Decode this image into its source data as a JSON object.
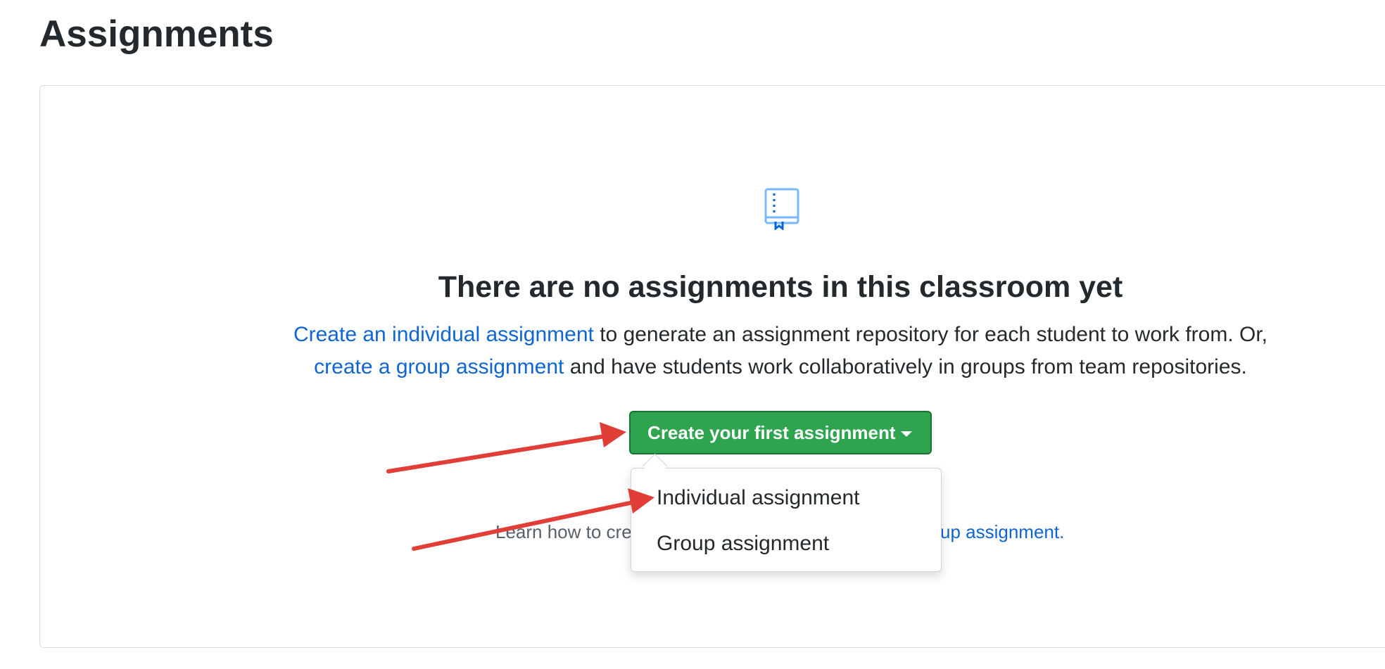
{
  "page": {
    "title": "Assignments"
  },
  "empty_state": {
    "icon": "book-icon",
    "headline": "There are no assignments in this classroom yet",
    "line1_link": "Create an individual assignment",
    "line1_rest": " to generate an assignment repository for each student to work from. Or,",
    "line2_link": "create a group assignment",
    "line2_rest": " and have students work collaboratively in groups from team repositories."
  },
  "create_button": {
    "label": "Create your first assignment",
    "icon": "caret-down-icon",
    "color": "#2ea44f"
  },
  "dropdown": {
    "items": [
      {
        "label": "Individual assignment"
      },
      {
        "label": "Group assignment"
      }
    ]
  },
  "help": {
    "text_visible": "Learn how to cre",
    "link_visible": "up assignment."
  },
  "annotations": {
    "arrow_color": "#e03e36"
  },
  "colors": {
    "link": "#0f66d2",
    "text": "#24292e",
    "muted": "#586069"
  }
}
